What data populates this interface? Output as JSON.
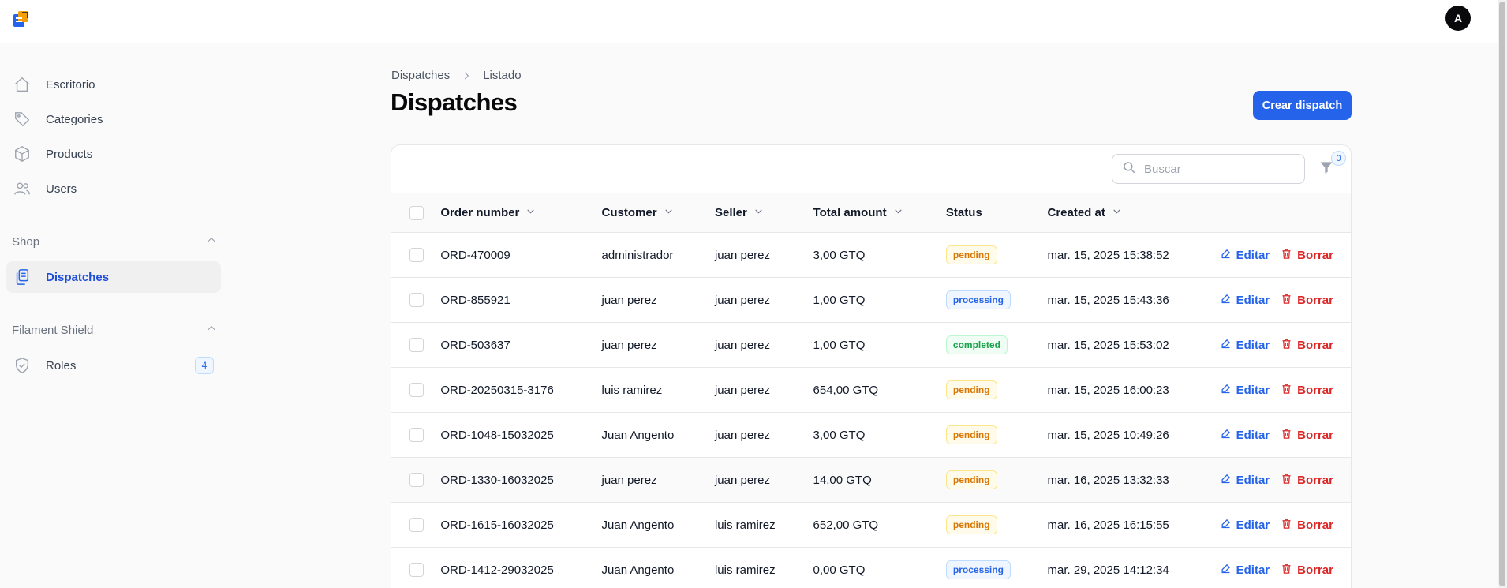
{
  "header": {
    "avatar_initial": "A",
    "logo_icon": "app-logo-icon"
  },
  "sidebar": {
    "items": [
      {
        "label": "Escritorio",
        "icon": "home-icon"
      },
      {
        "label": "Categories",
        "icon": "tag-icon"
      },
      {
        "label": "Products",
        "icon": "cube-icon"
      },
      {
        "label": "Users",
        "icon": "users-icon"
      }
    ],
    "groups": [
      {
        "label": "Shop",
        "items": [
          {
            "label": "Dispatches",
            "icon": "clipboard-icon",
            "active": true
          }
        ]
      },
      {
        "label": "Filament Shield",
        "items": [
          {
            "label": "Roles",
            "icon": "shield-icon",
            "badge": "4"
          }
        ]
      }
    ]
  },
  "page": {
    "breadcrumb": [
      "Dispatches",
      "Listado"
    ],
    "title": "Dispatches",
    "create_button": "Crear dispatch"
  },
  "table": {
    "search_placeholder": "Buscar",
    "filter_count": "0",
    "columns": {
      "order": "Order number",
      "customer": "Customer",
      "seller": "Seller",
      "total": "Total amount",
      "status": "Status",
      "created": "Created at"
    },
    "edit_label": "Editar",
    "delete_label": "Borrar",
    "rows": [
      {
        "order": "ORD-470009",
        "customer": "administrador",
        "seller": "juan perez",
        "total": "3,00 GTQ",
        "status": "pending",
        "created": "mar. 15, 2025 15:38:52"
      },
      {
        "order": "ORD-855921",
        "customer": "juan perez",
        "seller": "juan perez",
        "total": "1,00 GTQ",
        "status": "processing",
        "created": "mar. 15, 2025 15:43:36"
      },
      {
        "order": "ORD-503637",
        "customer": "juan perez",
        "seller": "juan perez",
        "total": "1,00 GTQ",
        "status": "completed",
        "created": "mar. 15, 2025 15:53:02"
      },
      {
        "order": "ORD-20250315-3176",
        "customer": "luis ramirez",
        "seller": "juan perez",
        "total": "654,00 GTQ",
        "status": "pending",
        "created": "mar. 15, 2025 16:00:23"
      },
      {
        "order": "ORD-1048-15032025",
        "customer": "Juan Angento",
        "seller": "juan perez",
        "total": "3,00 GTQ",
        "status": "pending",
        "created": "mar. 15, 2025 10:49:26"
      },
      {
        "order": "ORD-1330-16032025",
        "customer": "juan perez",
        "seller": "juan perez",
        "total": "14,00 GTQ",
        "status": "pending",
        "created": "mar. 16, 2025 13:32:33"
      },
      {
        "order": "ORD-1615-16032025",
        "customer": "Juan Angento",
        "seller": "luis ramirez",
        "total": "652,00 GTQ",
        "status": "pending",
        "created": "mar. 16, 2025 16:15:55"
      },
      {
        "order": "ORD-1412-29032025",
        "customer": "Juan Angento",
        "seller": "luis ramirez",
        "total": "0,00 GTQ",
        "status": "processing",
        "created": "mar. 29, 2025 14:12:34"
      }
    ]
  },
  "colors": {
    "primary": "#2563eb",
    "danger": "#dc2626",
    "pending": "#d97706",
    "processing": "#2563eb",
    "completed": "#16a34a"
  }
}
